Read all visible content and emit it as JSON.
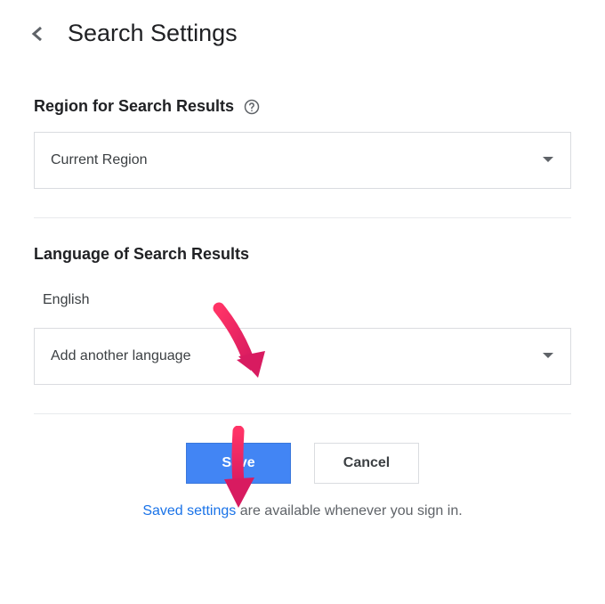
{
  "header": {
    "title": "Search Settings"
  },
  "region_section": {
    "label": "Region for Search Results",
    "selected": "Current Region"
  },
  "language_section": {
    "label": "Language of Search Results",
    "current": "English",
    "add_label": "Add another language"
  },
  "buttons": {
    "save": "Save",
    "cancel": "Cancel"
  },
  "footer": {
    "link": "Saved settings",
    "rest": " are available whenever you sign in."
  },
  "colors": {
    "primary": "#4285f4",
    "link": "#1a73e8",
    "annotation": "#e91e63"
  }
}
